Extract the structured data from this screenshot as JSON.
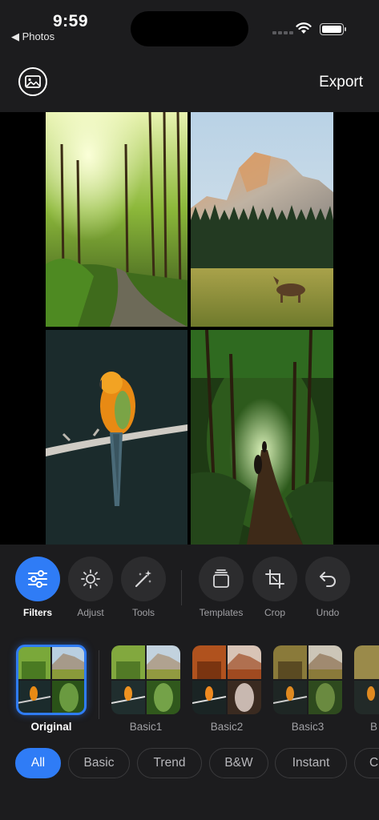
{
  "status_bar": {
    "time": "9:59",
    "back_app": "◀ Photos"
  },
  "header": {
    "export_label": "Export"
  },
  "toolbar": {
    "tools": [
      {
        "label": "Filters",
        "icon": "sliders-icon",
        "active": true
      },
      {
        "label": "Adjust",
        "icon": "brightness-icon"
      },
      {
        "label": "Tools",
        "icon": "magic-wand-icon"
      },
      {
        "label": "Templates",
        "icon": "templates-icon"
      },
      {
        "label": "Crop",
        "icon": "crop-icon"
      },
      {
        "label": "Undo",
        "icon": "undo-icon"
      }
    ]
  },
  "filters": {
    "items": [
      {
        "label": "Original",
        "selected": true
      },
      {
        "label": "Basic1"
      },
      {
        "label": "Basic2"
      },
      {
        "label": "Basic3"
      },
      {
        "label": "B"
      }
    ]
  },
  "categories": {
    "items": [
      {
        "label": "All",
        "active": true
      },
      {
        "label": "Basic"
      },
      {
        "label": "Trend"
      },
      {
        "label": "B&W"
      },
      {
        "label": "Instant"
      },
      {
        "label": "C"
      }
    ]
  },
  "colors": {
    "accent": "#2f7cf6",
    "background": "#1c1c1e",
    "control": "#2c2c2e"
  }
}
